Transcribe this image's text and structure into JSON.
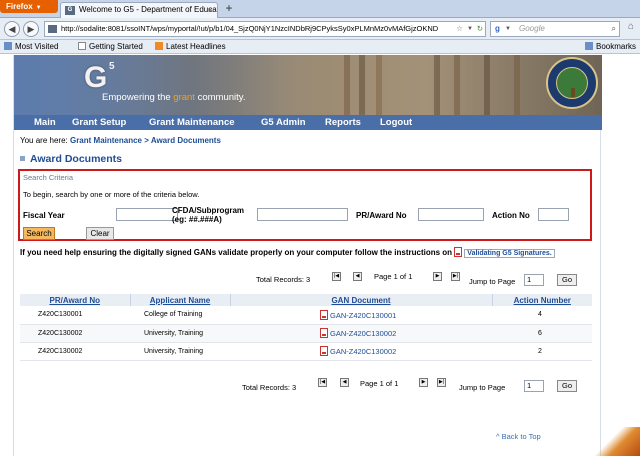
{
  "browser": {
    "menu_label": "Firefox",
    "tab_title": "Welcome to G5 - Department of Educatio...",
    "url": "http://sodalite:8081/ssoINT/wps/myportal/!ut/p/b1/04_SjzQ0NjY1NzcINDbRj9CPyksSy0xPLMnMz0vMAfGjzOKND",
    "search_placeholder": "Google",
    "bookmarks": [
      "Most Visited",
      "Getting Started",
      "Latest Headlines"
    ],
    "bookmarks_right": "Bookmarks"
  },
  "banner": {
    "logo": "G",
    "logo_sup": "5",
    "tagline_pre": "Empowering the ",
    "tagline_highlight": "grant",
    "tagline_post": " community."
  },
  "menu": [
    "Main",
    "Grant Setup",
    "Grant Maintenance",
    "G5 Admin",
    "Reports",
    "Logout"
  ],
  "breadcrumb": {
    "prefix": "You are here: ",
    "items": [
      "Grant Maintenance",
      "Award Documents"
    ],
    "sep": " > "
  },
  "page_title": "Award Documents",
  "search": {
    "title": "Search Criteria",
    "instructions": "To begin, search by one or more of the criteria below.",
    "fiscal_year_label": "Fiscal Year",
    "cfda_label_1": "CFDA/Subprogram",
    "cfda_label_2": "(eg: ##.###A)",
    "pr_award_label": "PR/Award No",
    "action_label": "Action No",
    "fiscal_year_value": "",
    "cfda_value": "",
    "pr_award_value": "",
    "action_value": "",
    "search_button": "Search",
    "clear_button": "Clear"
  },
  "gans_notice": "If you need help ensuring the digitally signed GANs validate properly on your computer follow the instructions on",
  "gans_link": "Validating G5 Signatures.",
  "pager": {
    "total_label": "Total Records: 3",
    "page_label": "Page 1 of 1",
    "jump_label": "Jump to Page",
    "jump_value": "1",
    "go": "Go"
  },
  "table": {
    "headers": [
      "PR/Award No",
      "Applicant Name",
      "GAN Document",
      "Action Number"
    ],
    "rows": [
      {
        "award": "Z420C130001",
        "applicant": "College of Training",
        "doc": "GAN-Z420C130001",
        "action": "4"
      },
      {
        "award": "Z420C130002",
        "applicant": "University, Training",
        "doc": "GAN-Z420C130002",
        "action": "6"
      },
      {
        "award": "Z420C130002",
        "applicant": "University, Training",
        "doc": "GAN-Z420C130002",
        "action": "2"
      }
    ]
  },
  "back_to_top": "^ Back to Top"
}
